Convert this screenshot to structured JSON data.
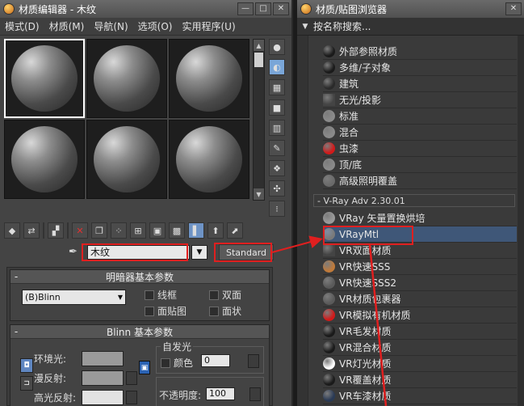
{
  "left_window": {
    "title": "材质编辑器 - 木纹",
    "win_buttons": [
      "—",
      "□",
      "✕"
    ],
    "menus": [
      "模式(D)",
      "材质(M)",
      "导航(N)",
      "选项(O)",
      "实用程序(U)"
    ],
    "material_name": "木纹",
    "material_type": "Standard",
    "shader_rollout": {
      "title": "明暗器基本参数",
      "shader": "(B)Blinn",
      "options": [
        "线框",
        "双面",
        "面贴图",
        "面状"
      ]
    },
    "blinn_rollout": {
      "title": "Blinn 基本参数",
      "ambient_label": "环境光:",
      "diffuse_label": "漫反射:",
      "specular_label": "高光反射:",
      "self_illum_title": "自发光",
      "color_label": "颜色",
      "color_value": "0",
      "opacity_label": "不透明度:",
      "opacity_value": "100"
    }
  },
  "right_window": {
    "title": "材质/贴图浏览器",
    "win_buttons": [
      "✕"
    ],
    "search_placeholder": "按名称搜索...",
    "standard_items": [
      {
        "label": "外部参照材质",
        "icon": "#1a1a1a"
      },
      {
        "label": "多维/子对象",
        "icon": "#1a1a1a"
      },
      {
        "label": "建筑",
        "icon": "#2a2a2a"
      },
      {
        "label": "无光/投影",
        "icon": "#444444"
      },
      {
        "label": "标准",
        "icon": "#8a8a8a"
      },
      {
        "label": "混合",
        "icon": "#8a8a8a"
      },
      {
        "label": "虫漆",
        "icon": "#d21a1a"
      },
      {
        "label": "顶/底",
        "icon": "#8a8a8a"
      },
      {
        "label": "高级照明覆盖",
        "icon": "#6a6a6a"
      }
    ],
    "vray_group_label": "- V-Ray Adv 2.30.01",
    "vray_items": [
      {
        "label": "VRay 矢量置换烘培",
        "icon": "#9a9a9a"
      },
      {
        "label": "VRayMtl",
        "icon": "#7a7a7a"
      },
      {
        "label": "VR双面材质",
        "icon": "#444444"
      },
      {
        "label": "VR快速SSS",
        "icon": "#c07a3a"
      },
      {
        "label": "VR快速SSS2",
        "icon": "#5a5a5a"
      },
      {
        "label": "VR材质包裹器",
        "icon": "#5a5a5a"
      },
      {
        "label": "VR模拟有机材质",
        "icon": "#d21a1a"
      },
      {
        "label": "VR毛发材质",
        "icon": "#1a1a1a"
      },
      {
        "label": "VR混合材质",
        "icon": "#1a1a1a"
      },
      {
        "label": "VR灯光材质",
        "icon": "#ffffff"
      },
      {
        "label": "VR覆盖材质",
        "icon": "#1a1a1a"
      },
      {
        "label": "VR车漆材质",
        "icon": "#2a3a55"
      }
    ]
  },
  "colors": {
    "accent": "#e01f1f",
    "selection": "#3f5778"
  }
}
